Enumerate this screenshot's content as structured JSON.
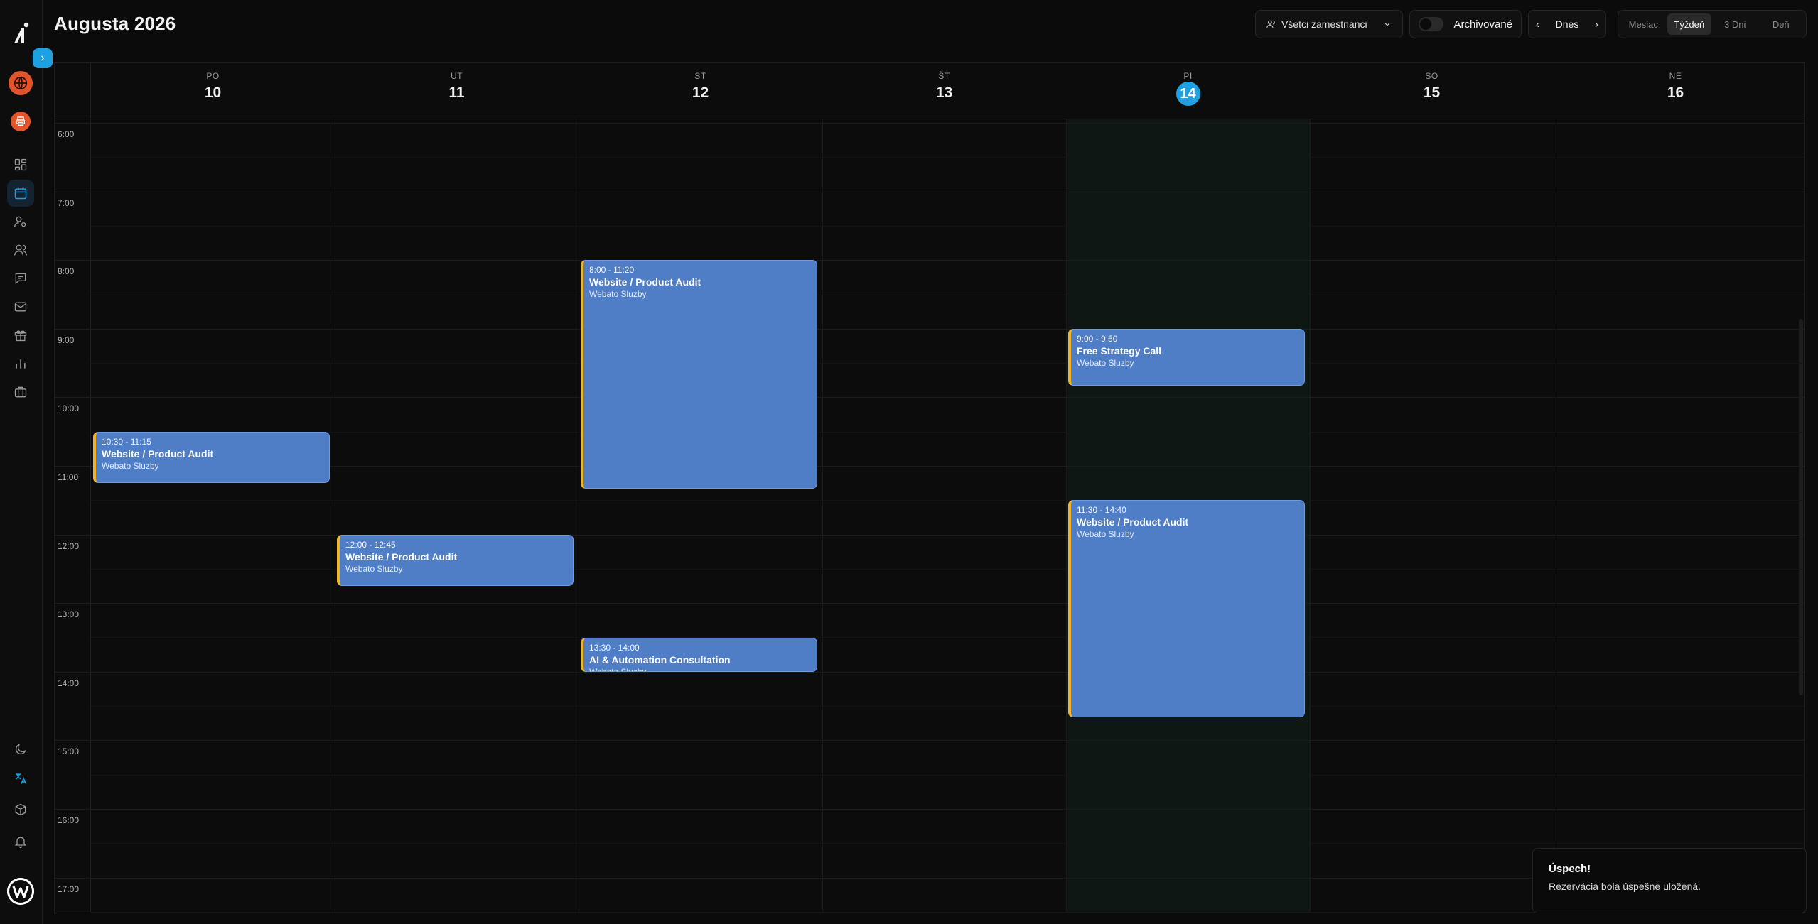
{
  "header": {
    "title": "Augusta 2026",
    "employee_filter": "Všetci zamestnanci",
    "archived_label": "Archivované",
    "today_label": "Dnes",
    "views": [
      "Mesiac",
      "Týždeň",
      "3 Dni",
      "Deň"
    ],
    "active_view": "Týždeň"
  },
  "days": [
    {
      "dow": "PO",
      "num": "10",
      "today": false
    },
    {
      "dow": "UT",
      "num": "11",
      "today": false
    },
    {
      "dow": "ST",
      "num": "12",
      "today": false
    },
    {
      "dow": "ŠT",
      "num": "13",
      "today": false
    },
    {
      "dow": "PI",
      "num": "14",
      "today": true
    },
    {
      "dow": "SO",
      "num": "15",
      "today": false
    },
    {
      "dow": "NE",
      "num": "16",
      "today": false
    }
  ],
  "hours": [
    "6:00",
    "7:00",
    "8:00",
    "9:00",
    "10:00",
    "11:00",
    "12:00",
    "13:00",
    "14:00",
    "15:00",
    "16:00",
    "17:00"
  ],
  "events": [
    {
      "day": 0,
      "start": 10.5,
      "end": 11.25,
      "time": "10:30 - 11:15",
      "title": "Website / Product Audit",
      "sub": "Webato Sluzby"
    },
    {
      "day": 1,
      "start": 12.0,
      "end": 12.75,
      "time": "12:00 - 12:45",
      "title": "Website / Product Audit",
      "sub": "Webato Sluzby"
    },
    {
      "day": 2,
      "start": 8.0,
      "end": 11.3333,
      "time": "8:00 - 11:20",
      "title": "Website / Product Audit",
      "sub": "Webato Sluzby"
    },
    {
      "day": 2,
      "start": 13.5,
      "end": 14.0,
      "time": "13:30 - 14:00",
      "title": "AI & Automation Consultation",
      "sub": "Webato Sluzby"
    },
    {
      "day": 4,
      "start": 9.0,
      "end": 9.8333,
      "time": "9:00 - 9:50",
      "title": "Free Strategy Call",
      "sub": "Webato Sluzby"
    },
    {
      "day": 4,
      "start": 11.5,
      "end": 14.6667,
      "time": "11:30 - 14:40",
      "title": "Website / Product Audit",
      "sub": "Webato Sluzby"
    }
  ],
  "toast": {
    "title": "Úspech!",
    "message": "Rezervácia bola úspešne uložená."
  },
  "icons": {
    "sidebar": [
      "globe-icon",
      "printer-icon",
      "dashboard-icon",
      "calendar-icon",
      "user-settings-icon",
      "users-icon",
      "chat-icon",
      "mail-icon",
      "gift-icon",
      "chart-icon",
      "briefcase-icon",
      "moon-icon",
      "translate-icon",
      "box-icon",
      "bell-icon"
    ]
  },
  "colors": {
    "accent": "#1da1e0",
    "event_bg": "#4f7ec7",
    "event_border": "#f0b429",
    "org_badge": "#e2542a"
  }
}
